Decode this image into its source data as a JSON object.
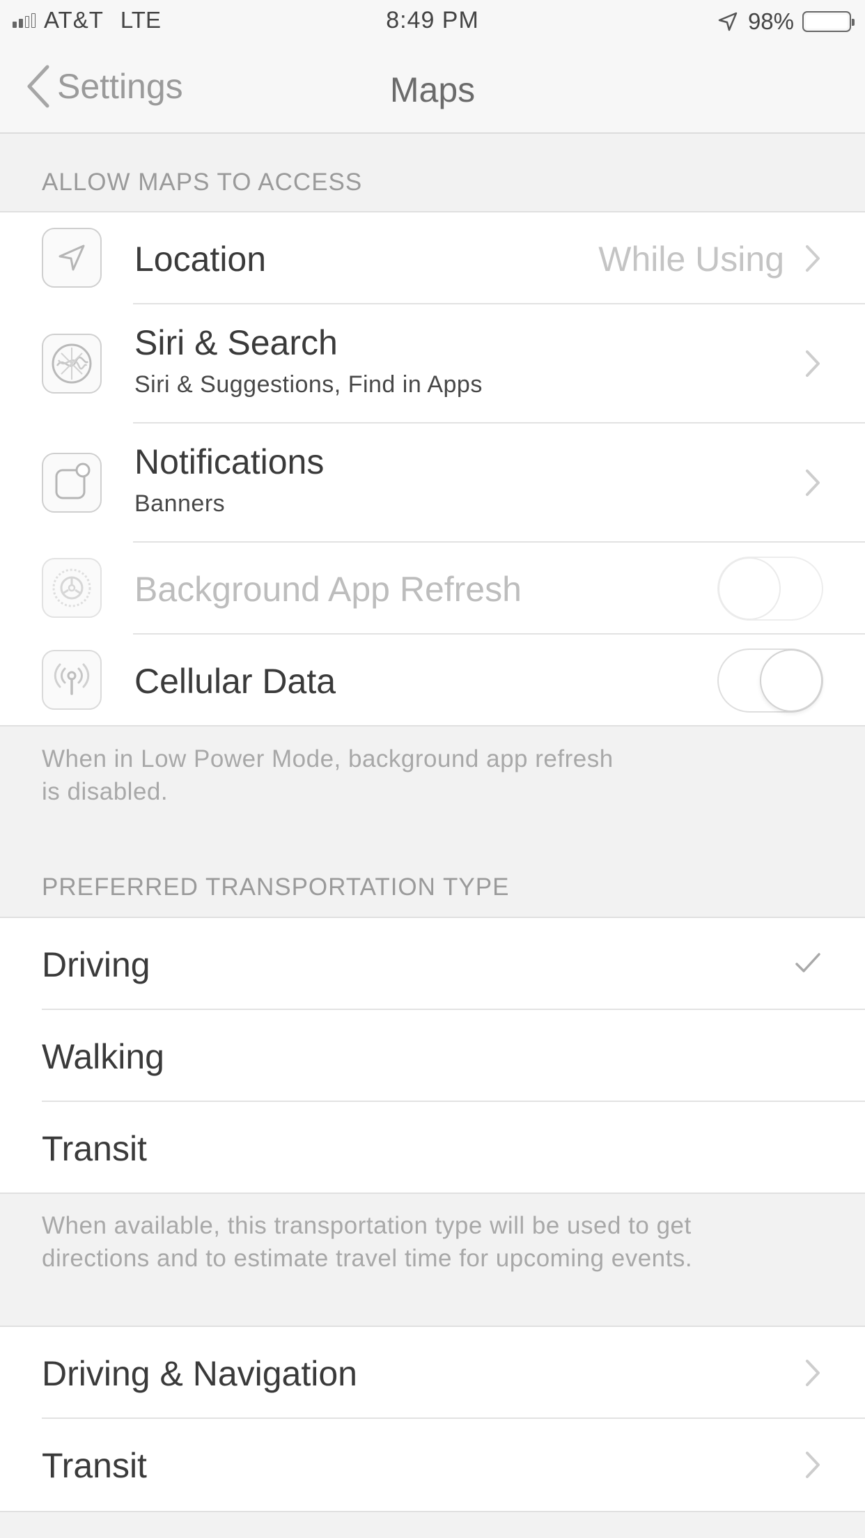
{
  "status_bar": {
    "carrier": "AT&T",
    "network": "LTE",
    "time": "8:49 PM",
    "battery_percent": "98%",
    "icons": [
      "signal-icon",
      "location-arrow-icon",
      "battery-icon"
    ]
  },
  "nav": {
    "back_label": "Settings",
    "title": "Maps"
  },
  "access_section": {
    "header": "ALLOW MAPS TO ACCESS",
    "rows": [
      {
        "title": "Location",
        "value": "While Using",
        "icon": "location-arrow-icon"
      },
      {
        "title": "Siri & Search",
        "subtitle": "Siri & Suggestions, Find in Apps",
        "icon": "siri-icon"
      },
      {
        "title": "Notifications",
        "subtitle": "Banners",
        "icon": "notifications-icon"
      },
      {
        "title": "Background App Refresh",
        "enabled": false,
        "toggle_on": false,
        "icon": "background-refresh-gear-icon"
      },
      {
        "title": "Cellular Data",
        "toggle_on": false,
        "icon": "cellular-antenna-icon"
      }
    ],
    "footer": [
      "When in Low Power Mode, background app refresh",
      "is disabled."
    ]
  },
  "transport_section": {
    "header": "PREFERRED TRANSPORTATION TYPE",
    "options": [
      {
        "label": "Driving",
        "selected": true
      },
      {
        "label": "Walking",
        "selected": false
      },
      {
        "label": "Transit",
        "selected": false
      }
    ],
    "footer": [
      "When available, this transportation type will be used to get",
      "directions and to estimate travel time for upcoming events."
    ]
  },
  "more_section": {
    "rows": [
      {
        "label": "Driving & Navigation"
      },
      {
        "label": "Transit"
      }
    ]
  }
}
